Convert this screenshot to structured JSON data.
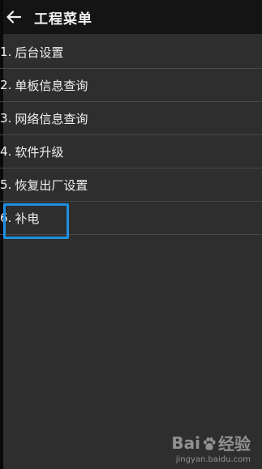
{
  "app_bar": {
    "back_icon": "arrow-left-icon",
    "title": "工程菜单"
  },
  "menu": {
    "items": [
      {
        "num": "1.",
        "label": "后台设置"
      },
      {
        "num": "2.",
        "label": "单板信息查询"
      },
      {
        "num": "3.",
        "label": "网络信息查询"
      },
      {
        "num": "4.",
        "label": "软件升级"
      },
      {
        "num": "5.",
        "label": "恢复出厂设置"
      },
      {
        "num": "6.",
        "label": "补电"
      }
    ],
    "highlighted_item": "6. 补电"
  },
  "watermark": {
    "logo_left": "Bai",
    "logo_right": "经验",
    "url": "jingyan.baidu.com"
  },
  "colors": {
    "background": "#2e2e2e",
    "app_bar": "#141414",
    "highlight": "#1e8fe0",
    "text": "#f0f0f0"
  }
}
